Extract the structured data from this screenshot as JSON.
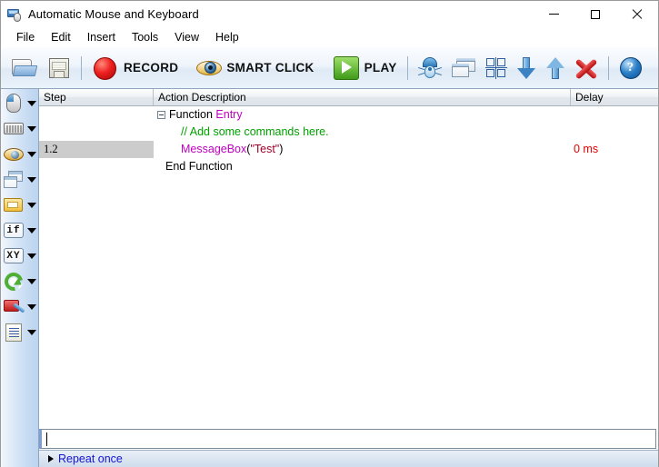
{
  "window": {
    "title": "Automatic Mouse and Keyboard",
    "icon": "app-monitor-mouse-icon",
    "controls": {
      "minimize": "minimize-icon",
      "maximize": "maximize-icon",
      "close": "close-icon"
    }
  },
  "menubar": {
    "items": [
      {
        "label": "File"
      },
      {
        "label": "Edit"
      },
      {
        "label": "Insert"
      },
      {
        "label": "Tools"
      },
      {
        "label": "View"
      },
      {
        "label": "Help"
      }
    ]
  },
  "toolbar": {
    "open_icon": "open-folder-icon",
    "save_icon": "floppy-save-icon",
    "record_icon": "red-record-dot-icon",
    "record_label": "RECORD",
    "smartclick_icon": "eye-icon",
    "smartclick_label": "SMART CLICK",
    "play_icon": "green-play-icon",
    "play_label": "PLAY",
    "debug_icon": "bug-icon",
    "window_icon": "windows-icon",
    "grid_icon": "grid-select-icon",
    "move_down_icon": "arrow-down-icon",
    "move_up_icon": "arrow-up-icon",
    "delete_icon": "red-x-delete-icon",
    "help_icon": "help-question-icon",
    "help_glyph": "?"
  },
  "sidebar": {
    "items": [
      {
        "icon": "mouse-icon",
        "name": "mouse-commands"
      },
      {
        "icon": "keyboard-icon",
        "name": "keyboard-commands"
      },
      {
        "icon": "eye-icon",
        "name": "smart-click-commands"
      },
      {
        "icon": "windows-icon",
        "name": "window-commands"
      },
      {
        "icon": "folder-icon",
        "name": "file-commands"
      },
      {
        "icon": "if-icon",
        "name": "condition-commands",
        "text": "if"
      },
      {
        "icon": "xy-icon",
        "name": "coordinate-commands",
        "text": "XY"
      },
      {
        "icon": "loop-icon",
        "name": "loop-commands"
      },
      {
        "icon": "toolbox-icon",
        "name": "tool-commands"
      },
      {
        "icon": "script-icon",
        "name": "script-commands"
      }
    ]
  },
  "list": {
    "columns": [
      {
        "label": "Step"
      },
      {
        "label": "Action Description"
      },
      {
        "label": "Delay"
      }
    ],
    "rows": [
      {
        "step": "",
        "selected": false,
        "indent": "ind0",
        "expander": true,
        "segments": [
          {
            "text": "Function ",
            "style": "kw"
          },
          {
            "text": "Entry",
            "style": "purple"
          }
        ],
        "delay": ""
      },
      {
        "step": "",
        "selected": false,
        "indent": "ind1",
        "expander": false,
        "segments": [
          {
            "text": "// Add some commands here.",
            "style": "green"
          }
        ],
        "delay": ""
      },
      {
        "step": "1.2",
        "selected": true,
        "indent": "ind1",
        "expander": false,
        "segments": [
          {
            "text": "MessageBox",
            "style": "purple"
          },
          {
            "text": "(",
            "style": "kw"
          },
          {
            "text": "\"Test\"",
            "style": "darkred"
          },
          {
            "text": ")",
            "style": "kw"
          }
        ],
        "delay": "0 ms"
      },
      {
        "step": "",
        "selected": false,
        "indent": "ind2",
        "expander": false,
        "segments": [
          {
            "text": "End Function",
            "style": "kw"
          }
        ],
        "delay": ""
      }
    ]
  },
  "command_input": {
    "value": "",
    "placeholder": ""
  },
  "statusbar": {
    "repeat_label": "Repeat once",
    "triangle_icon": "play-triangle-icon"
  },
  "colors": {
    "keyword_purple": "#c000c0",
    "comment_green": "#00a000",
    "string_darkred": "#a00028",
    "delay_red": "#e00000",
    "link_blue": "#1414d2",
    "selection_gray": "#cccccc"
  }
}
